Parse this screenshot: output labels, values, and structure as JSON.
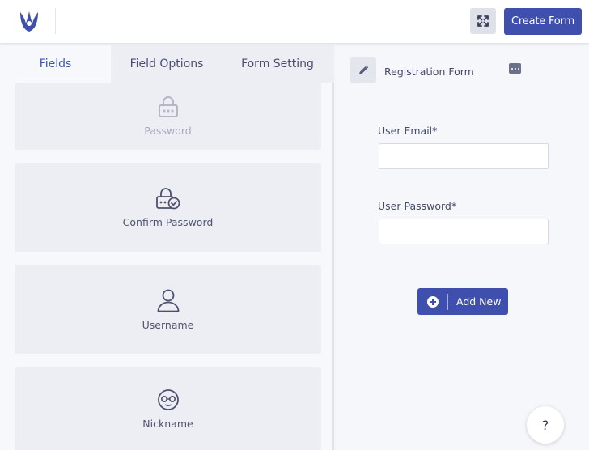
{
  "header": {
    "logo_icon": "brand-logo-icon",
    "expand_icon": "expand-icon",
    "create_form_label": "Create Form"
  },
  "tabs": [
    {
      "label": "Fields",
      "active": true
    },
    {
      "label": "Field Options",
      "active": false
    },
    {
      "label": "Form Setting",
      "active": false
    }
  ],
  "fields": [
    {
      "label": "Password",
      "icon": "password-lock-icon"
    },
    {
      "label": "Confirm Password",
      "icon": "confirm-password-lock-icon"
    },
    {
      "label": "Username",
      "icon": "user-icon"
    },
    {
      "label": "Nickname",
      "icon": "nickname-face-icon"
    }
  ],
  "form": {
    "title": "Registration Form",
    "edit_icon": "pencil-icon",
    "menu_icon": "more-icon",
    "fields": [
      {
        "label": "User Email*",
        "value": "",
        "placeholder": ""
      },
      {
        "label": "User Password*",
        "value": "",
        "placeholder": ""
      }
    ],
    "add_new_label": "Add New"
  },
  "help": {
    "label": "?"
  },
  "colors": {
    "accent": "#3f4fae",
    "active_tab_text": "#3d55a8",
    "card_bg": "#eceef3",
    "text": "#45496b"
  }
}
